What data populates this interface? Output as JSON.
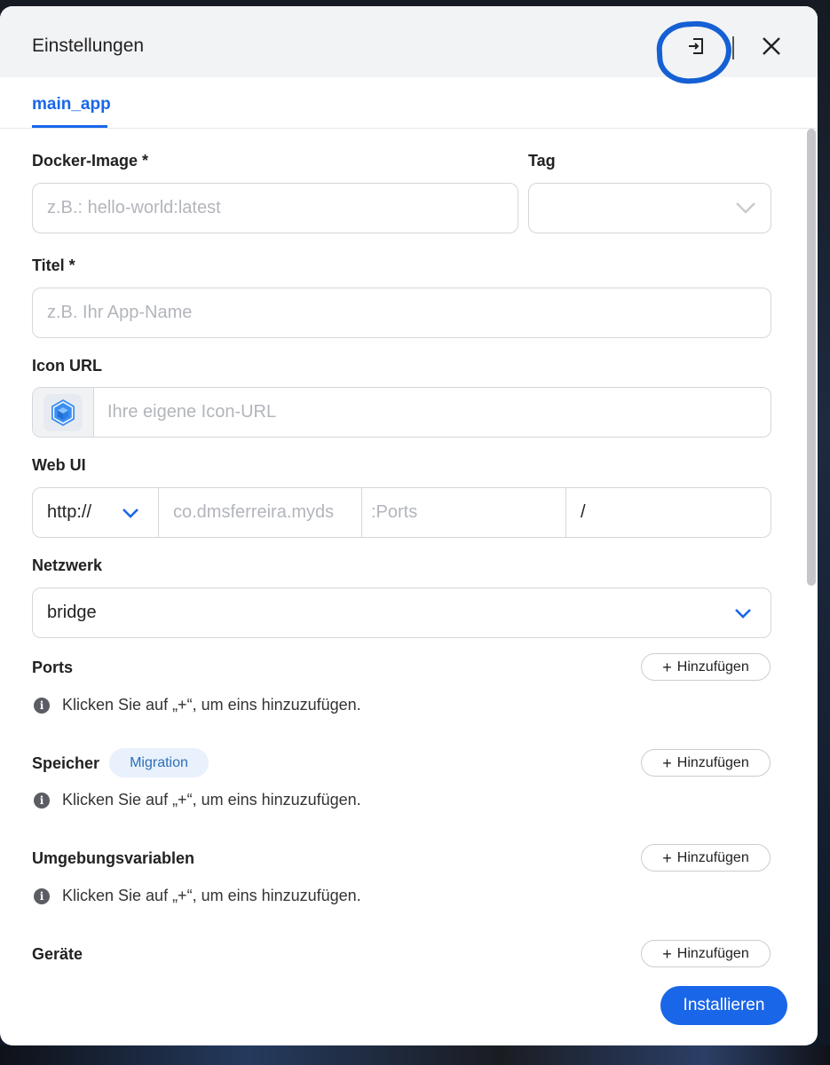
{
  "dialog": {
    "title": "Einstellungen",
    "import_icon": "import-icon",
    "close_icon": "close-icon",
    "accent_color": "#1a66e8",
    "annotation_color": "#1460d4"
  },
  "tabs": [
    {
      "label": "main_app",
      "active": true
    }
  ],
  "form": {
    "docker_image": {
      "label": "Docker-Image *",
      "placeholder": "z.B.: hello-world:latest",
      "value": ""
    },
    "tag": {
      "label": "Tag",
      "value": ""
    },
    "title": {
      "label": "Titel *",
      "placeholder": "z.B. Ihr App-Name",
      "value": ""
    },
    "icon_url": {
      "label": "Icon URL",
      "placeholder": "Ihre eigene Icon-URL",
      "icon": "cube-icon"
    },
    "web_ui": {
      "label": "Web UI",
      "protocol": "http://",
      "host_placeholder": "co.dmsferreira.myds",
      "port_placeholder": ":Ports",
      "path": "/"
    },
    "network": {
      "label": "Netzwerk",
      "value": "bridge"
    }
  },
  "sections": {
    "ports": {
      "label": "Ports",
      "add_label": "Hinzufügen",
      "info": "Klicken Sie auf „+“, um eins hinzuzufügen."
    },
    "storage": {
      "label": "Speicher",
      "badge": "Migration",
      "add_label": "Hinzufügen",
      "info": "Klicken Sie auf „+“, um eins hinzuzufügen."
    },
    "env": {
      "label": "Umgebungsvariablen",
      "add_label": "Hinzufügen",
      "info": "Klicken Sie auf „+“, um eins hinzuzufügen."
    },
    "devices": {
      "label": "Geräte",
      "add_label": "Hinzufügen"
    }
  },
  "footer": {
    "install_label": "Installieren"
  }
}
